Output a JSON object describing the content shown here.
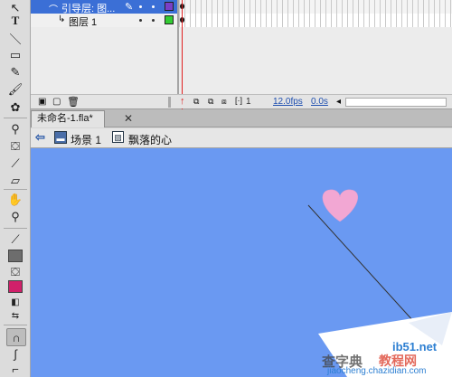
{
  "colors": {
    "stage": "#6a99f2",
    "heart": "#f2a7d3",
    "fill_swatch": "#d0206a",
    "stroke_swatch": "#6d6d6d",
    "guide_layer_square": "#7a3fc7",
    "layer1_square": "#33cc33"
  },
  "timeline": {
    "layers": [
      {
        "name": "引导层: 图...",
        "kind": "guide",
        "selected": true
      },
      {
        "name": "图层 1",
        "kind": "normal",
        "selected": false
      }
    ],
    "current_frame": "1",
    "fps": "12.0fps",
    "time": "0.0s"
  },
  "document": {
    "tab_label": "未命名-1.fla*",
    "close_glyph": "✕"
  },
  "editbar": {
    "scene": "场景 1",
    "symbol": "飘落的心",
    "back_icon": "back-arrow-icon"
  },
  "tools": [
    "subselection-icon",
    "text-icon",
    "line-icon",
    "rectangle-icon",
    "pencil-icon",
    "brush-icon",
    "deco-icon",
    "bone-icon",
    "paint-bucket-icon",
    "eyedropper-icon",
    "eraser-icon",
    "hand-icon",
    "zoom-icon",
    "stroke-color-icon",
    "fill-color-icon",
    "black-white-icon",
    "swap-colors-icon",
    "snap-magnet-icon",
    "smooth-icon",
    "straighten-icon"
  ],
  "watermark": {
    "site": "ib51.net",
    "left": "查字典",
    "mid": "教程网",
    "url": "jiaocheng.chazidian.com"
  }
}
